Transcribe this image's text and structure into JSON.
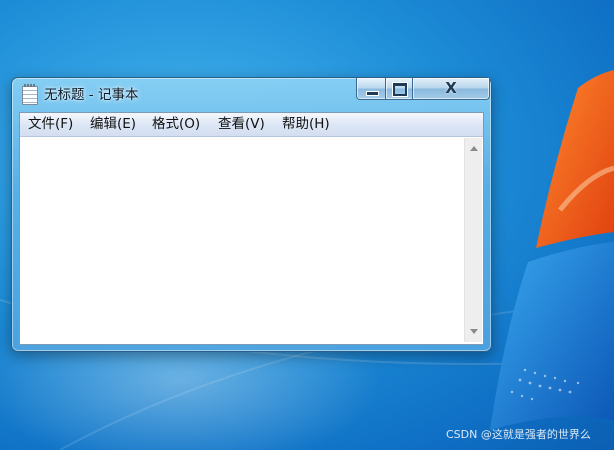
{
  "window": {
    "title": "无标题 - 记事本",
    "buttons": {
      "minimize": "—",
      "maximize": "□",
      "close": "X"
    }
  },
  "menubar": {
    "items": [
      {
        "label": "文件(F)"
      },
      {
        "label": "编辑(E)"
      },
      {
        "label": "格式(O)"
      },
      {
        "label": "查看(V)"
      },
      {
        "label": "帮助(H)"
      }
    ]
  },
  "editor": {
    "content": ""
  },
  "watermark": {
    "text": "CSDN @这就是强者的世界么"
  },
  "icons": [
    "notepad-icon",
    "minimize-icon",
    "maximize-icon",
    "close-icon",
    "scroll-up-arrow-icon",
    "scroll-down-arrow-icon"
  ],
  "colors": {
    "desktop": "#1e8ed8",
    "logo_orange": "#f26a1b",
    "logo_blue": "#1c7fd6"
  }
}
